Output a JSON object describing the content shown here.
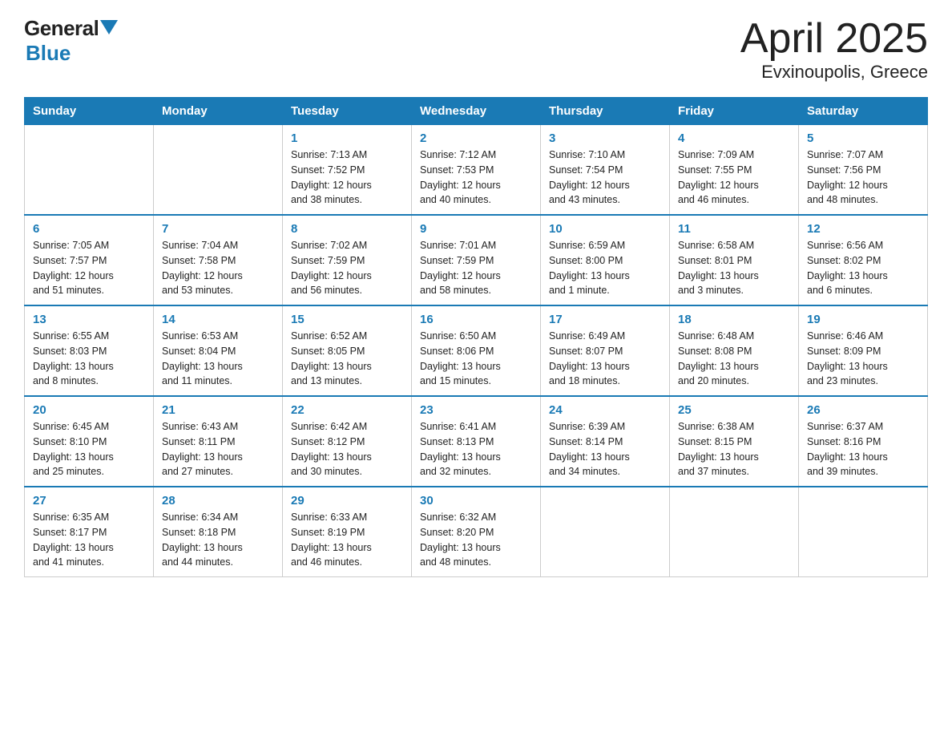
{
  "logo": {
    "general": "General",
    "blue": "Blue"
  },
  "title": "April 2025",
  "subtitle": "Evxinoupolis, Greece",
  "weekdays": [
    "Sunday",
    "Monday",
    "Tuesday",
    "Wednesday",
    "Thursday",
    "Friday",
    "Saturday"
  ],
  "weeks": [
    [
      {
        "day": "",
        "info": ""
      },
      {
        "day": "",
        "info": ""
      },
      {
        "day": "1",
        "info": "Sunrise: 7:13 AM\nSunset: 7:52 PM\nDaylight: 12 hours\nand 38 minutes."
      },
      {
        "day": "2",
        "info": "Sunrise: 7:12 AM\nSunset: 7:53 PM\nDaylight: 12 hours\nand 40 minutes."
      },
      {
        "day": "3",
        "info": "Sunrise: 7:10 AM\nSunset: 7:54 PM\nDaylight: 12 hours\nand 43 minutes."
      },
      {
        "day": "4",
        "info": "Sunrise: 7:09 AM\nSunset: 7:55 PM\nDaylight: 12 hours\nand 46 minutes."
      },
      {
        "day": "5",
        "info": "Sunrise: 7:07 AM\nSunset: 7:56 PM\nDaylight: 12 hours\nand 48 minutes."
      }
    ],
    [
      {
        "day": "6",
        "info": "Sunrise: 7:05 AM\nSunset: 7:57 PM\nDaylight: 12 hours\nand 51 minutes."
      },
      {
        "day": "7",
        "info": "Sunrise: 7:04 AM\nSunset: 7:58 PM\nDaylight: 12 hours\nand 53 minutes."
      },
      {
        "day": "8",
        "info": "Sunrise: 7:02 AM\nSunset: 7:59 PM\nDaylight: 12 hours\nand 56 minutes."
      },
      {
        "day": "9",
        "info": "Sunrise: 7:01 AM\nSunset: 7:59 PM\nDaylight: 12 hours\nand 58 minutes."
      },
      {
        "day": "10",
        "info": "Sunrise: 6:59 AM\nSunset: 8:00 PM\nDaylight: 13 hours\nand 1 minute."
      },
      {
        "day": "11",
        "info": "Sunrise: 6:58 AM\nSunset: 8:01 PM\nDaylight: 13 hours\nand 3 minutes."
      },
      {
        "day": "12",
        "info": "Sunrise: 6:56 AM\nSunset: 8:02 PM\nDaylight: 13 hours\nand 6 minutes."
      }
    ],
    [
      {
        "day": "13",
        "info": "Sunrise: 6:55 AM\nSunset: 8:03 PM\nDaylight: 13 hours\nand 8 minutes."
      },
      {
        "day": "14",
        "info": "Sunrise: 6:53 AM\nSunset: 8:04 PM\nDaylight: 13 hours\nand 11 minutes."
      },
      {
        "day": "15",
        "info": "Sunrise: 6:52 AM\nSunset: 8:05 PM\nDaylight: 13 hours\nand 13 minutes."
      },
      {
        "day": "16",
        "info": "Sunrise: 6:50 AM\nSunset: 8:06 PM\nDaylight: 13 hours\nand 15 minutes."
      },
      {
        "day": "17",
        "info": "Sunrise: 6:49 AM\nSunset: 8:07 PM\nDaylight: 13 hours\nand 18 minutes."
      },
      {
        "day": "18",
        "info": "Sunrise: 6:48 AM\nSunset: 8:08 PM\nDaylight: 13 hours\nand 20 minutes."
      },
      {
        "day": "19",
        "info": "Sunrise: 6:46 AM\nSunset: 8:09 PM\nDaylight: 13 hours\nand 23 minutes."
      }
    ],
    [
      {
        "day": "20",
        "info": "Sunrise: 6:45 AM\nSunset: 8:10 PM\nDaylight: 13 hours\nand 25 minutes."
      },
      {
        "day": "21",
        "info": "Sunrise: 6:43 AM\nSunset: 8:11 PM\nDaylight: 13 hours\nand 27 minutes."
      },
      {
        "day": "22",
        "info": "Sunrise: 6:42 AM\nSunset: 8:12 PM\nDaylight: 13 hours\nand 30 minutes."
      },
      {
        "day": "23",
        "info": "Sunrise: 6:41 AM\nSunset: 8:13 PM\nDaylight: 13 hours\nand 32 minutes."
      },
      {
        "day": "24",
        "info": "Sunrise: 6:39 AM\nSunset: 8:14 PM\nDaylight: 13 hours\nand 34 minutes."
      },
      {
        "day": "25",
        "info": "Sunrise: 6:38 AM\nSunset: 8:15 PM\nDaylight: 13 hours\nand 37 minutes."
      },
      {
        "day": "26",
        "info": "Sunrise: 6:37 AM\nSunset: 8:16 PM\nDaylight: 13 hours\nand 39 minutes."
      }
    ],
    [
      {
        "day": "27",
        "info": "Sunrise: 6:35 AM\nSunset: 8:17 PM\nDaylight: 13 hours\nand 41 minutes."
      },
      {
        "day": "28",
        "info": "Sunrise: 6:34 AM\nSunset: 8:18 PM\nDaylight: 13 hours\nand 44 minutes."
      },
      {
        "day": "29",
        "info": "Sunrise: 6:33 AM\nSunset: 8:19 PM\nDaylight: 13 hours\nand 46 minutes."
      },
      {
        "day": "30",
        "info": "Sunrise: 6:32 AM\nSunset: 8:20 PM\nDaylight: 13 hours\nand 48 minutes."
      },
      {
        "day": "",
        "info": ""
      },
      {
        "day": "",
        "info": ""
      },
      {
        "day": "",
        "info": ""
      }
    ]
  ]
}
